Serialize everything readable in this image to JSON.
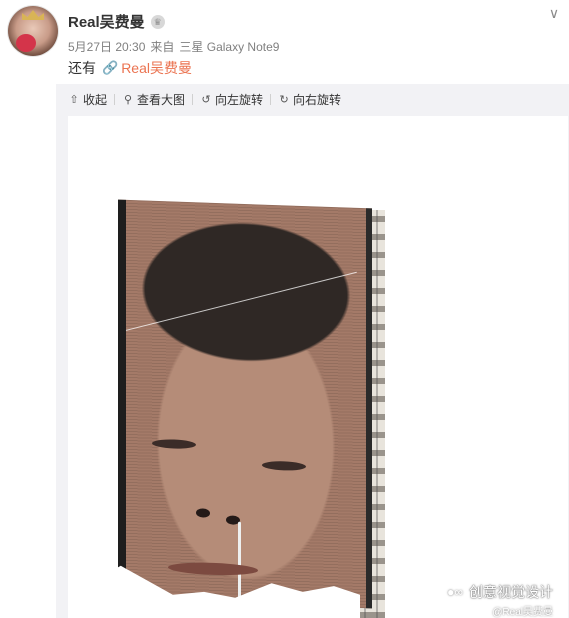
{
  "post": {
    "user_name": "Real吴费曼",
    "vip_badge": "♛",
    "date": "5月27日 20:30",
    "from_label": "来自",
    "device": "三星 Galaxy Note9",
    "text": "还有",
    "link_text": "Real吴费曼",
    "link_color": "#eb7350"
  },
  "toolbar": {
    "items": [
      {
        "icon": "collapse-icon",
        "label": "收起"
      },
      {
        "icon": "zoom-icon",
        "label": "查看大图"
      },
      {
        "icon": "rotate-left-icon",
        "label": "向左旋转"
      },
      {
        "icon": "rotate-right-icon",
        "label": "向右旋转"
      }
    ]
  },
  "watermark": {
    "main": "创意视觉设计",
    "sub": "@Real吴费曼"
  }
}
